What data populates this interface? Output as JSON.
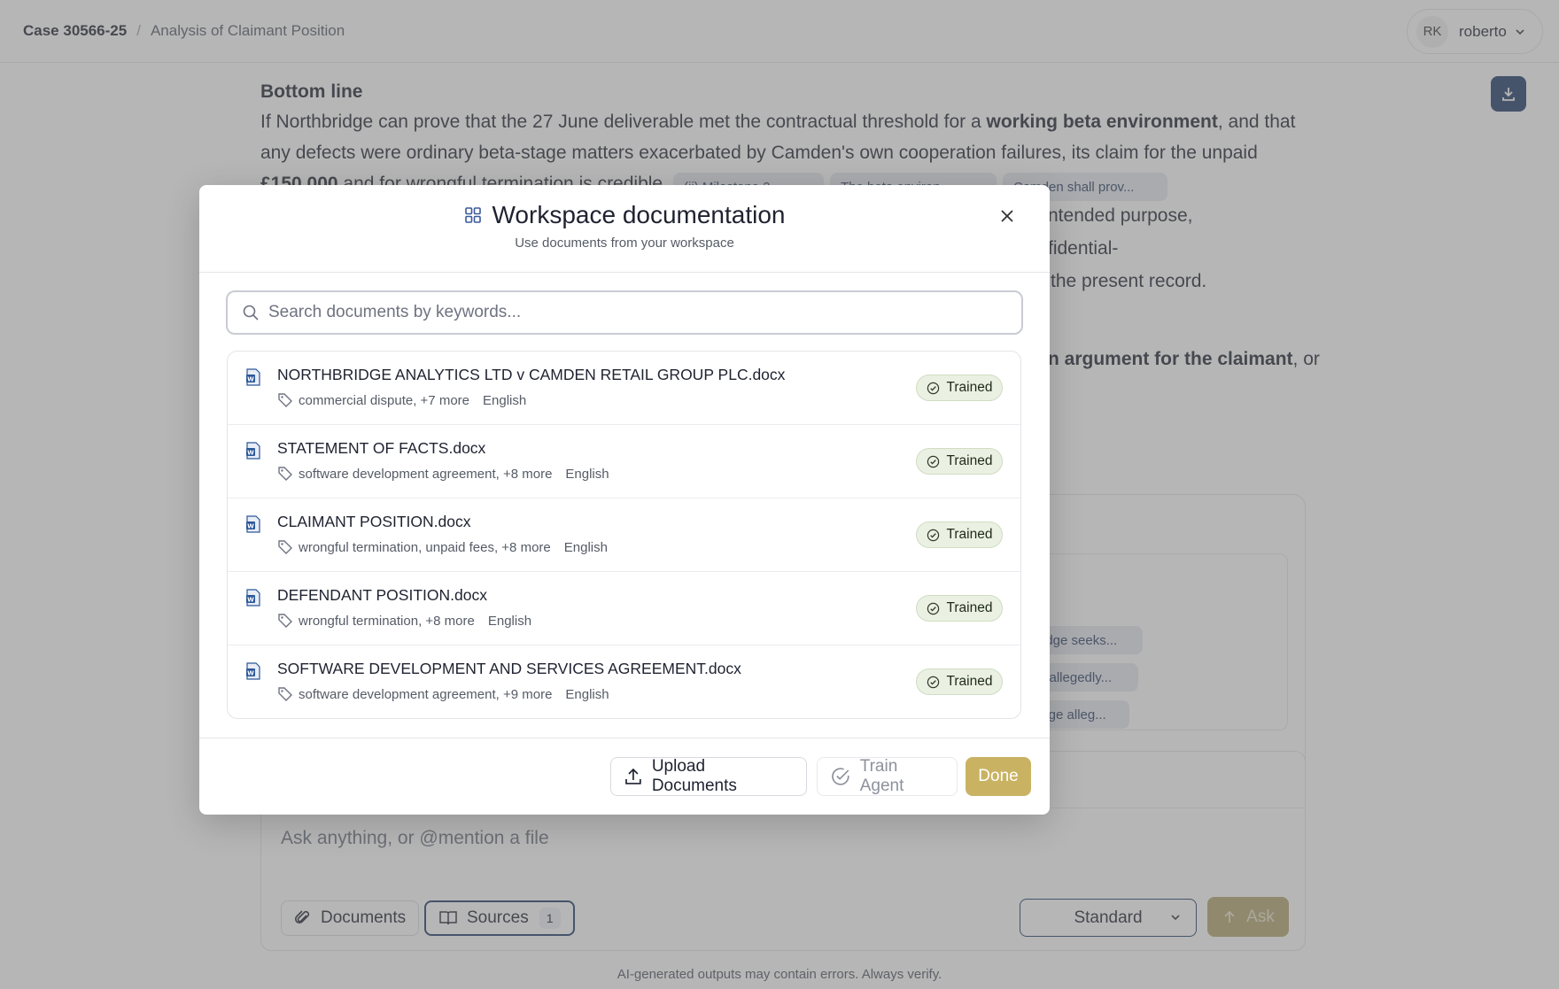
{
  "header": {
    "case_label": "Case 30566-25",
    "separator": "/",
    "page_title": "Analysis of Claimant Position",
    "user_initials": "RK",
    "user_name": "roberto"
  },
  "article": {
    "heading": "Bottom line",
    "line1_pre": "If Northbridge can prove that the 27 June deliverable met the contractual threshold for a ",
    "line1_bold": "working beta environment",
    "line1_post": ", and that",
    "line2": "any defects were ordinary beta-stage matters exacerbated by Camden's own cooperation failures, its claim for the unpaid",
    "line3_bold": "£150,000",
    "line3_post": " and for wrongful termination is credible.",
    "line4_tail": "ntended purpose,",
    "line5_tail": "fidential-",
    "line6_tail": "the present record.",
    "line7_bold": "n argument for the claimant",
    "line7_post": ", or",
    "citations_row1": [
      "(ii) Milestone 2...",
      "The beta environ...",
      "Camden shall prov..."
    ],
    "citations_panel": [
      "ridge seeks...",
      "n allegedly...",
      "idge alleg..."
    ]
  },
  "composer": {
    "placeholder": "Ask anything, or @mention a file",
    "documents_label": "Documents",
    "sources_label": "Sources",
    "sources_count": "1",
    "mode_value": "Standard",
    "ask_label": "Ask"
  },
  "footer_note": "AI-generated outputs may contain errors. Always verify.",
  "modal": {
    "title": "Workspace documentation",
    "subtitle": "Use documents from your workspace",
    "search_placeholder": "Search documents by keywords...",
    "documents": [
      {
        "name": "NORTHBRIDGE ANALYTICS LTD v CAMDEN RETAIL GROUP PLC.docx",
        "tags": "commercial dispute, +7 more",
        "language": "English",
        "status": "Trained"
      },
      {
        "name": "STATEMENT OF FACTS.docx",
        "tags": "software development agreement, +8 more",
        "language": "English",
        "status": "Trained"
      },
      {
        "name": "CLAIMANT POSITION.docx",
        "tags": "wrongful termination, unpaid fees, +8 more",
        "language": "English",
        "status": "Trained"
      },
      {
        "name": "DEFENDANT POSITION.docx",
        "tags": "wrongful termination, +8 more",
        "language": "English",
        "status": "Trained"
      },
      {
        "name": "SOFTWARE DEVELOPMENT AND SERVICES AGREEMENT.docx",
        "tags": "software development agreement, +9 more",
        "language": "English",
        "status": "Trained"
      }
    ],
    "upload_label": "Upload Documents",
    "train_label": "Train Agent",
    "done_label": "Done"
  },
  "colors": {
    "accent_navy": "#1f3a68",
    "done_gold": "#c9b363",
    "trained_bg": "#eaf1e3"
  }
}
